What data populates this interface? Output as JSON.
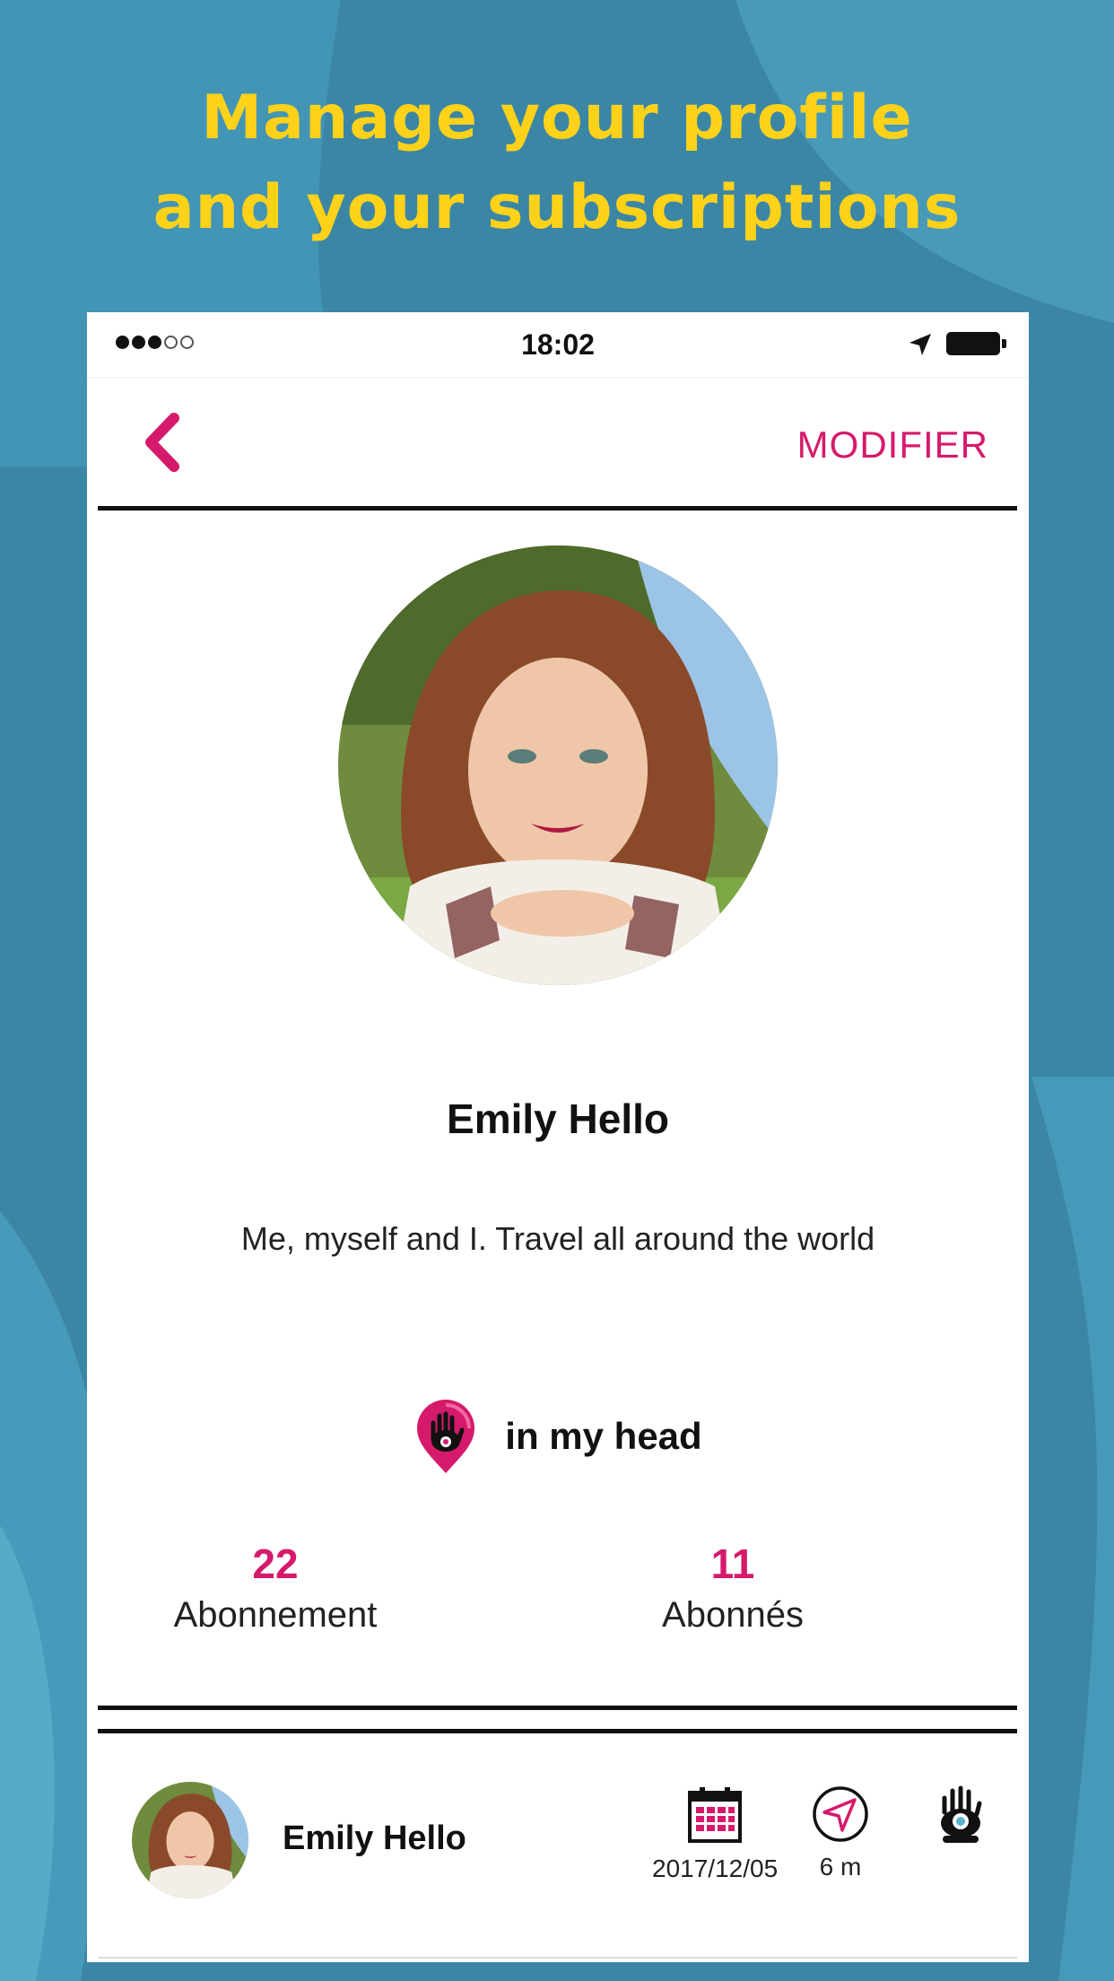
{
  "headline": {
    "line1": "Manage your profile",
    "line2": "and your subscriptions"
  },
  "status_bar": {
    "time": "18:02",
    "signal_full": 3,
    "signal_empty": 2,
    "battery_level": 1.0
  },
  "nav": {
    "back_icon": "chevron-left-icon",
    "edit_label": "MODIFIER"
  },
  "profile": {
    "name": "Emily Hello",
    "bio": "Me, myself and I.  Travel all around the world",
    "mood_icon": "hand-pin-icon",
    "mood_label": "in my head"
  },
  "stats": [
    {
      "value": "22",
      "label": "Abonnement"
    },
    {
      "value": "11",
      "label": "Abonnés"
    }
  ],
  "post": {
    "name": "Emily Hello",
    "date": "2017/12/05",
    "distance": "6 m",
    "icons": [
      "calendar-icon",
      "navigation-icon",
      "hand-eye-icon"
    ]
  },
  "colors": {
    "accent": "#d61a6b",
    "headline": "#ffd21a",
    "background": "#3b86a5"
  }
}
